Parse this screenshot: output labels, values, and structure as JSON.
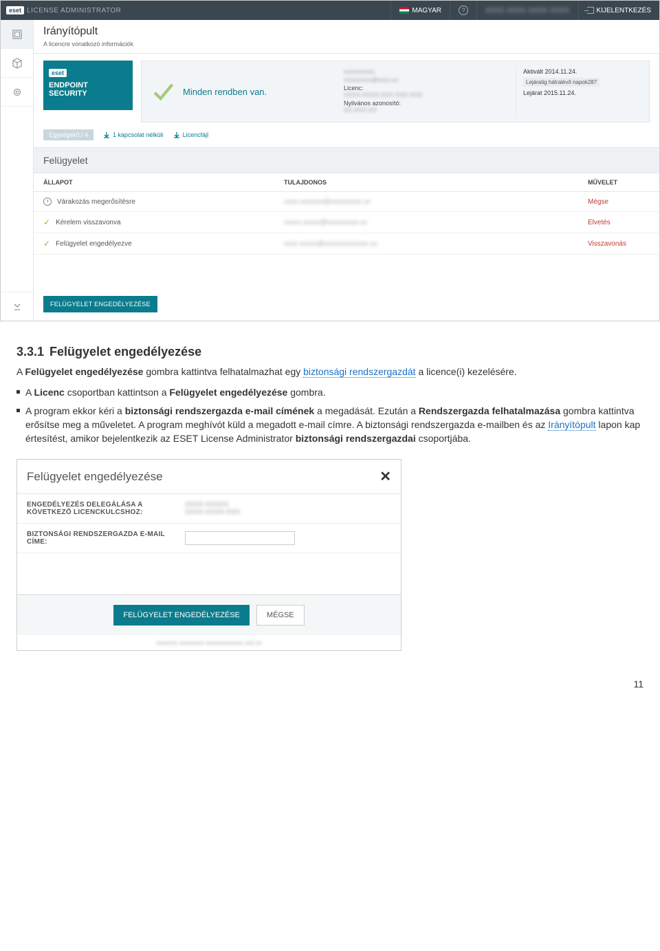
{
  "topbar": {
    "brand_box": "eset",
    "brand_text": "LICENSE ADMINISTRATOR",
    "lang": "MAGYAR",
    "user_blur": "XXXX XXXX XXXX XXXX",
    "logout": "KIJELENTKEZÉS"
  },
  "page": {
    "title": "Irányítópult",
    "subtitle": "A licencre vonatkozó információk"
  },
  "product": {
    "brand": "eset",
    "name_line1": "ENDPOINT",
    "name_line2": "SECURITY"
  },
  "status": {
    "text": "Minden rendben van."
  },
  "meta": {
    "owner_blur": "xxxxxxxxxx",
    "owner2_blur": "xxxxxxxxx@xxxx.xx",
    "lic_label": "Licenc:",
    "lic_blur": "XXXX-XXXX-XXX-XXX-XXX",
    "pubid_label": "Nyilvános azonosító:",
    "pubid_blur": "XX-XXX-XX"
  },
  "licinfo": {
    "activated": "Aktivált 2014.11.24.",
    "days_badge": "Lejáratig hátralévő napok287",
    "expires": "Lejárat 2015.11.24."
  },
  "units": {
    "badge": "Egységek0 / 4",
    "offline": "1 kapcsolat nélküli",
    "licfile": "Licencfájl"
  },
  "mgmt": {
    "heading": "Felügyelet",
    "cols": {
      "a": "ÁLLAPOT",
      "b": "TULAJDONOS",
      "c": "MŰVELET"
    },
    "rows": [
      {
        "icon": "clock",
        "status": "Várakozás megerősítésre",
        "owner": "xxxx.xxxxxxx@xxxxxxxxx.xx",
        "action": "Mégse"
      },
      {
        "icon": "check",
        "status": "Kérelem visszavonva",
        "owner": "xxxxx.xxxxx@xxxxxxxxx.xx",
        "action": "Elvetés"
      },
      {
        "icon": "check",
        "status": "Felügyelet engedélyezve",
        "owner": "xxxx.xxxxx@xxxxxxxxxxxxx.xx",
        "action": "Visszavonás"
      }
    ],
    "button": "FELÜGYELET ENGEDÉLYEZÉSE"
  },
  "doc": {
    "sec_num": "3.3.1",
    "sec_title": "Felügyelet engedélyezése",
    "intro_1": "A ",
    "intro_b1": "Felügyelet engedélyezése",
    "intro_2": " gombra kattintva felhatalmazhat egy ",
    "intro_link": "biztonsági rendszergazdát",
    "intro_3": " a licence(i) kezelésére.",
    "bul1_1": "A ",
    "bul1_b1": "Licenc",
    "bul1_2": " csoportban kattintson a ",
    "bul1_b2": "Felügyelet engedélyezése",
    "bul1_3": " gombra.",
    "bul2_1": "A program ekkor kéri a ",
    "bul2_b1": "biztonsági rendszergazda e-mail címének",
    "bul2_2": " a megadását. Ezután a ",
    "bul2_b2": "Rendszergazda felhatalmazása",
    "bul2_3": " gombra kattintva erősítse meg a műveletet. A program meghívót küld a megadott e-mail címre. A biztonsági rendszergazda e-mailben és az ",
    "bul2_link": "Irányítópult",
    "bul2_4": " lapon kap értesítést, amikor bejelentkezik az ESET License Administrator ",
    "bul2_b3": "biztonsági rendszergazdai",
    "bul2_5": " csoportjába."
  },
  "dialog": {
    "title": "Felügyelet engedélyezése",
    "row1_label": "ENGEDÉLYEZÉS DELEGÁLÁSA A KÖVETKEZŐ LICENCKULCSHOZ:",
    "row1_val": "XXXX-XXXXX\nXXXX-XXXX-XXX",
    "row2_label": "BIZTONSÁGI RENDSZERGAZDA E-MAIL CÍME:",
    "btn_primary": "FELÜGYELET ENGEDÉLYEZÉSE",
    "btn_cancel": "MÉGSE",
    "under_blur": "xxxxxxx xxxxxxxx xxxxxxxxxxxx.xxx.xx"
  },
  "page_number": "11"
}
